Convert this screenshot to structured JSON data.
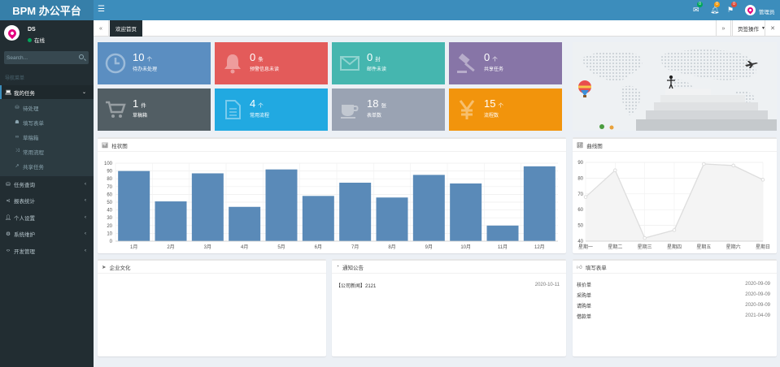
{
  "app": {
    "title": "BPM 办公平台"
  },
  "topbar": {
    "badges": [
      {
        "icon": "envelope-icon",
        "count": "0",
        "color": "#00a65a"
      },
      {
        "icon": "bell-icon",
        "count": "0",
        "color": "#f39c12"
      },
      {
        "icon": "flag-icon",
        "count": "0",
        "color": "#dd4b39"
      }
    ],
    "admin_name": "管理员"
  },
  "sidebar": {
    "user_name": "DS",
    "user_status": "在线",
    "search_placeholder": "Search...",
    "nav_header": "导航菜单",
    "active_menu": {
      "label": "我的任务",
      "icon": "laptop-icon"
    },
    "submenu": [
      {
        "label": "待处理",
        "icon": "database-icon"
      },
      {
        "label": "填写表单",
        "icon": "sitemap-icon"
      },
      {
        "label": "草稿箱",
        "icon": "binoculars-icon"
      },
      {
        "label": "常用流程",
        "icon": "random-icon"
      },
      {
        "label": "共享任务",
        "icon": "share-icon"
      }
    ],
    "menus": [
      {
        "label": "任务查询",
        "icon": "database-icon"
      },
      {
        "label": "报表统计",
        "icon": "share-alt-icon"
      },
      {
        "label": "个人设置",
        "icon": "user-icon"
      },
      {
        "label": "系统维护",
        "icon": "gear-icon"
      },
      {
        "label": "开发管理",
        "icon": "code-icon"
      }
    ]
  },
  "tabs": {
    "welcome": "欢迎首页",
    "page_ops": "页签操作"
  },
  "stats": [
    {
      "value": "10",
      "unit": "个",
      "label": "待办未处理",
      "color": "#5b8ec1",
      "icon": "clock-icon"
    },
    {
      "value": "0",
      "unit": "条",
      "label": "预警信息未读",
      "color": "#e35b5a",
      "icon": "bell-icon"
    },
    {
      "value": "0",
      "unit": "封",
      "label": "邮件未读",
      "color": "#45b6af",
      "icon": "envelope-icon"
    },
    {
      "value": "0",
      "unit": "个",
      "label": "共享任务",
      "color": "#8775a7",
      "icon": "gavel-icon"
    },
    {
      "value": "1",
      "unit": "件",
      "label": "草稿箱",
      "color": "#525e64",
      "icon": "cart-icon"
    },
    {
      "value": "4",
      "unit": "个",
      "label": "常用流程",
      "color": "#21a9e1",
      "icon": "file-icon"
    },
    {
      "value": "18",
      "unit": "张",
      "label": "表单数",
      "color": "#9aa3b3",
      "icon": "cup-icon"
    },
    {
      "value": "15",
      "unit": "个",
      "label": "流程数",
      "color": "#f2940c",
      "icon": "yen-icon"
    }
  ],
  "bar_panel": {
    "title": "柱状图"
  },
  "line_panel": {
    "title": "曲线图"
  },
  "chart_data": [
    {
      "type": "bar",
      "categories": [
        "1月",
        "2月",
        "3月",
        "4月",
        "5月",
        "6月",
        "7月",
        "8月",
        "9月",
        "10月",
        "11月",
        "12月"
      ],
      "values": [
        90,
        51,
        87,
        44,
        92,
        58,
        75,
        56,
        85,
        74,
        20,
        96
      ],
      "ylim": [
        0,
        100
      ],
      "yticks": [
        0,
        10,
        20,
        30,
        40,
        50,
        60,
        70,
        80,
        90,
        100
      ],
      "grid": true,
      "color": "#5a8ab8"
    },
    {
      "type": "area",
      "categories": [
        "星期一",
        "星期二",
        "星期三",
        "星期四",
        "星期五",
        "星期六",
        "星期日"
      ],
      "values": [
        68,
        85,
        42,
        47,
        89,
        88,
        79
      ],
      "ylim": [
        40,
        90
      ],
      "yticks": [
        40,
        50,
        60,
        70,
        80,
        90
      ],
      "grid": true,
      "color": "#dddddd"
    }
  ],
  "culture_panel": {
    "title": "企业文化"
  },
  "notice_panel": {
    "title": "通知公告",
    "items": [
      {
        "text": "【公司新闻】2121",
        "date": "2020-10-11"
      }
    ]
  },
  "form_panel": {
    "title": "填写表单",
    "items": [
      {
        "text": "核价单",
        "date": "2020-09-09"
      },
      {
        "text": "采购单",
        "date": "2020-09-09"
      },
      {
        "text": "请购单",
        "date": "2020-09-09"
      },
      {
        "text": "借款单",
        "date": "2021-04-09"
      }
    ]
  }
}
